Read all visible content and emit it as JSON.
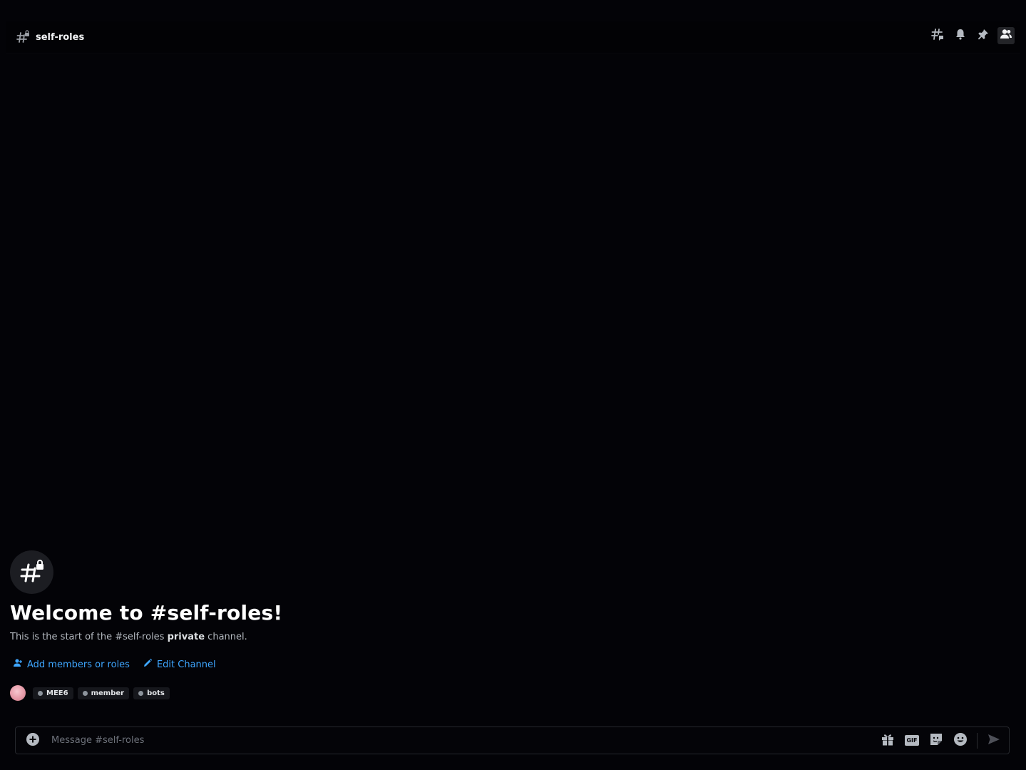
{
  "header": {
    "channel_name": "self-roles",
    "tools": [
      {
        "icon": "threads-icon"
      },
      {
        "icon": "bell-icon"
      },
      {
        "icon": "pin-icon"
      },
      {
        "icon": "member-list-icon"
      }
    ]
  },
  "welcome": {
    "title": "Welcome to #self-roles!",
    "desc_prefix": "This is the start of the #self-roles ",
    "desc_bold": "private",
    "desc_suffix": " channel.",
    "add_members_label": "Add members or roles",
    "edit_channel_label": "Edit Channel"
  },
  "members": {
    "tags": [
      {
        "label": "MEE6"
      },
      {
        "label": "member"
      },
      {
        "label": "bots"
      }
    ]
  },
  "composer": {
    "placeholder": "Message #self-roles",
    "gif_label": "GIF"
  },
  "colors": {
    "background": "#030307",
    "link": "#3ea6ff",
    "tag_bg": "#16171c"
  }
}
